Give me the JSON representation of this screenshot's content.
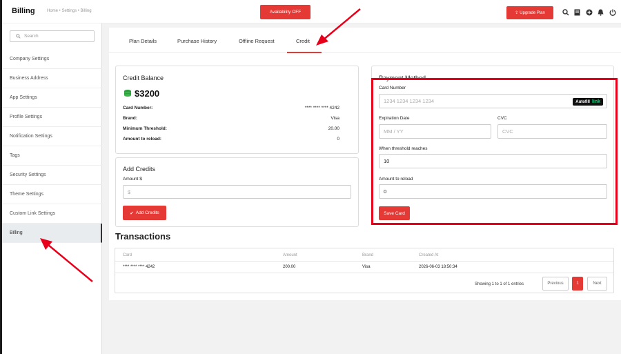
{
  "header": {
    "brand": "Billing",
    "breadcrumb": "Home • Settings • Billing",
    "availability_button": "Availability OFF",
    "upgrade_button": "Upgrade Plan",
    "icons": [
      "search-icon",
      "notes-icon",
      "add-circle-icon",
      "bell-icon",
      "power-icon"
    ]
  },
  "sidebar": {
    "search_placeholder": "Search",
    "items": [
      {
        "label": "Company Settings"
      },
      {
        "label": "Business Address"
      },
      {
        "label": "App Settings"
      },
      {
        "label": "Profile Settings"
      },
      {
        "label": "Notification Settings"
      },
      {
        "label": "Tags"
      },
      {
        "label": "Security Settings"
      },
      {
        "label": "Theme Settings"
      },
      {
        "label": "Custom Link Settings"
      },
      {
        "label": "Billing"
      }
    ],
    "active_item": "Billing"
  },
  "tabs": [
    {
      "label": "Plan Details"
    },
    {
      "label": "Purchase History"
    },
    {
      "label": "Offline Request"
    },
    {
      "label": "Credit"
    }
  ],
  "active_tab": "Credit",
  "credit_balance": {
    "title": "Credit Balance",
    "amount": "$3200",
    "rows": [
      {
        "label": "Card Number:",
        "value": "**** **** **** 4242"
      },
      {
        "label": "Brand:",
        "value": "Visa"
      },
      {
        "label": "Minimum Threshold:",
        "value": "20.00"
      },
      {
        "label": "Amount to reload:",
        "value": "0"
      }
    ]
  },
  "add_credits": {
    "title": "Add Credits",
    "amount_label": "Amount $",
    "amount_placeholder": "$",
    "button": "Add Credits"
  },
  "payment_method": {
    "title": "Payment Method",
    "card_number_label": "Card Number",
    "card_number_placeholder": "1234 1234 1234 1234",
    "autofill_label": "Autofill",
    "autofill_link": "link",
    "expiration_label": "Expiration Date",
    "expiration_placeholder": "MM / YY",
    "cvc_label": "CVC",
    "cvc_placeholder": "CVC",
    "threshold_label": "When threshold reaches",
    "threshold_value": "10",
    "reload_label": "Amount to reload",
    "reload_value": "0",
    "save_button": "Save Card"
  },
  "transactions": {
    "title": "Transactions",
    "columns": [
      "Card",
      "Amount",
      "Brand",
      "Created At"
    ],
    "rows": [
      {
        "card": "**** **** **** 4242",
        "amount": "200.00",
        "brand": "Visa",
        "created_at": "2026-06-03 18:50:34"
      }
    ],
    "summary": "Showing 1 to 1 of 1 entries",
    "prev": "Previous",
    "page": "1",
    "next": "Next"
  },
  "colors": {
    "accent": "#e53935",
    "annotation": "#e8001a"
  }
}
